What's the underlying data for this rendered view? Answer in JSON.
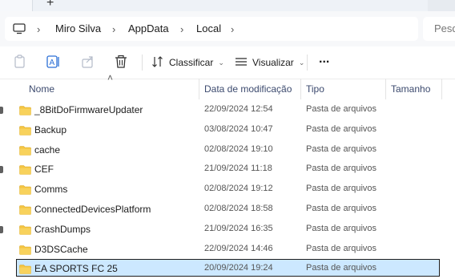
{
  "address": {
    "crumbs": [
      "Miro Silva",
      "AppData",
      "Local"
    ],
    "search_placeholder": "Pesq"
  },
  "commandbar": {
    "sort_label": "Classificar",
    "view_label": "Visualizar",
    "more_label": "..."
  },
  "columns": {
    "name": "Nome",
    "modified": "Data de modificação",
    "type": "Tipo",
    "size": "Tamanho"
  },
  "files": [
    {
      "name": "_8BitDoFirmwareUpdater",
      "modified": "22/09/2024 12:54",
      "type": "Pasta de arquivos"
    },
    {
      "name": "Backup",
      "modified": "03/08/2024 10:47",
      "type": "Pasta de arquivos"
    },
    {
      "name": "cache",
      "modified": "02/08/2024 19:10",
      "type": "Pasta de arquivos"
    },
    {
      "name": "CEF",
      "modified": "21/09/2024 11:18",
      "type": "Pasta de arquivos"
    },
    {
      "name": "Comms",
      "modified": "02/08/2024 19:12",
      "type": "Pasta de arquivos"
    },
    {
      "name": "ConnectedDevicesPlatform",
      "modified": "02/08/2024 18:58",
      "type": "Pasta de arquivos"
    },
    {
      "name": "CrashDumps",
      "modified": "21/09/2024 16:35",
      "type": "Pasta de arquivos"
    },
    {
      "name": "D3DSCache",
      "modified": "22/09/2024 14:46",
      "type": "Pasta de arquivos"
    },
    {
      "name": "EA SPORTS FC 25",
      "modified": "20/09/2024 19:24",
      "type": "Pasta de arquivos",
      "selected": true
    }
  ],
  "icons": {
    "folder": "folder-icon",
    "computer": "computer-icon",
    "copy": "copy-icon",
    "rename": "rename-icon",
    "share": "share-icon",
    "delete": "trash-icon",
    "sort": "sort-icon",
    "view": "view-icon"
  },
  "colors": {
    "folder_fill": "#f5c542",
    "selection": "#cce8ff",
    "header_text": "#3c4a6e"
  }
}
